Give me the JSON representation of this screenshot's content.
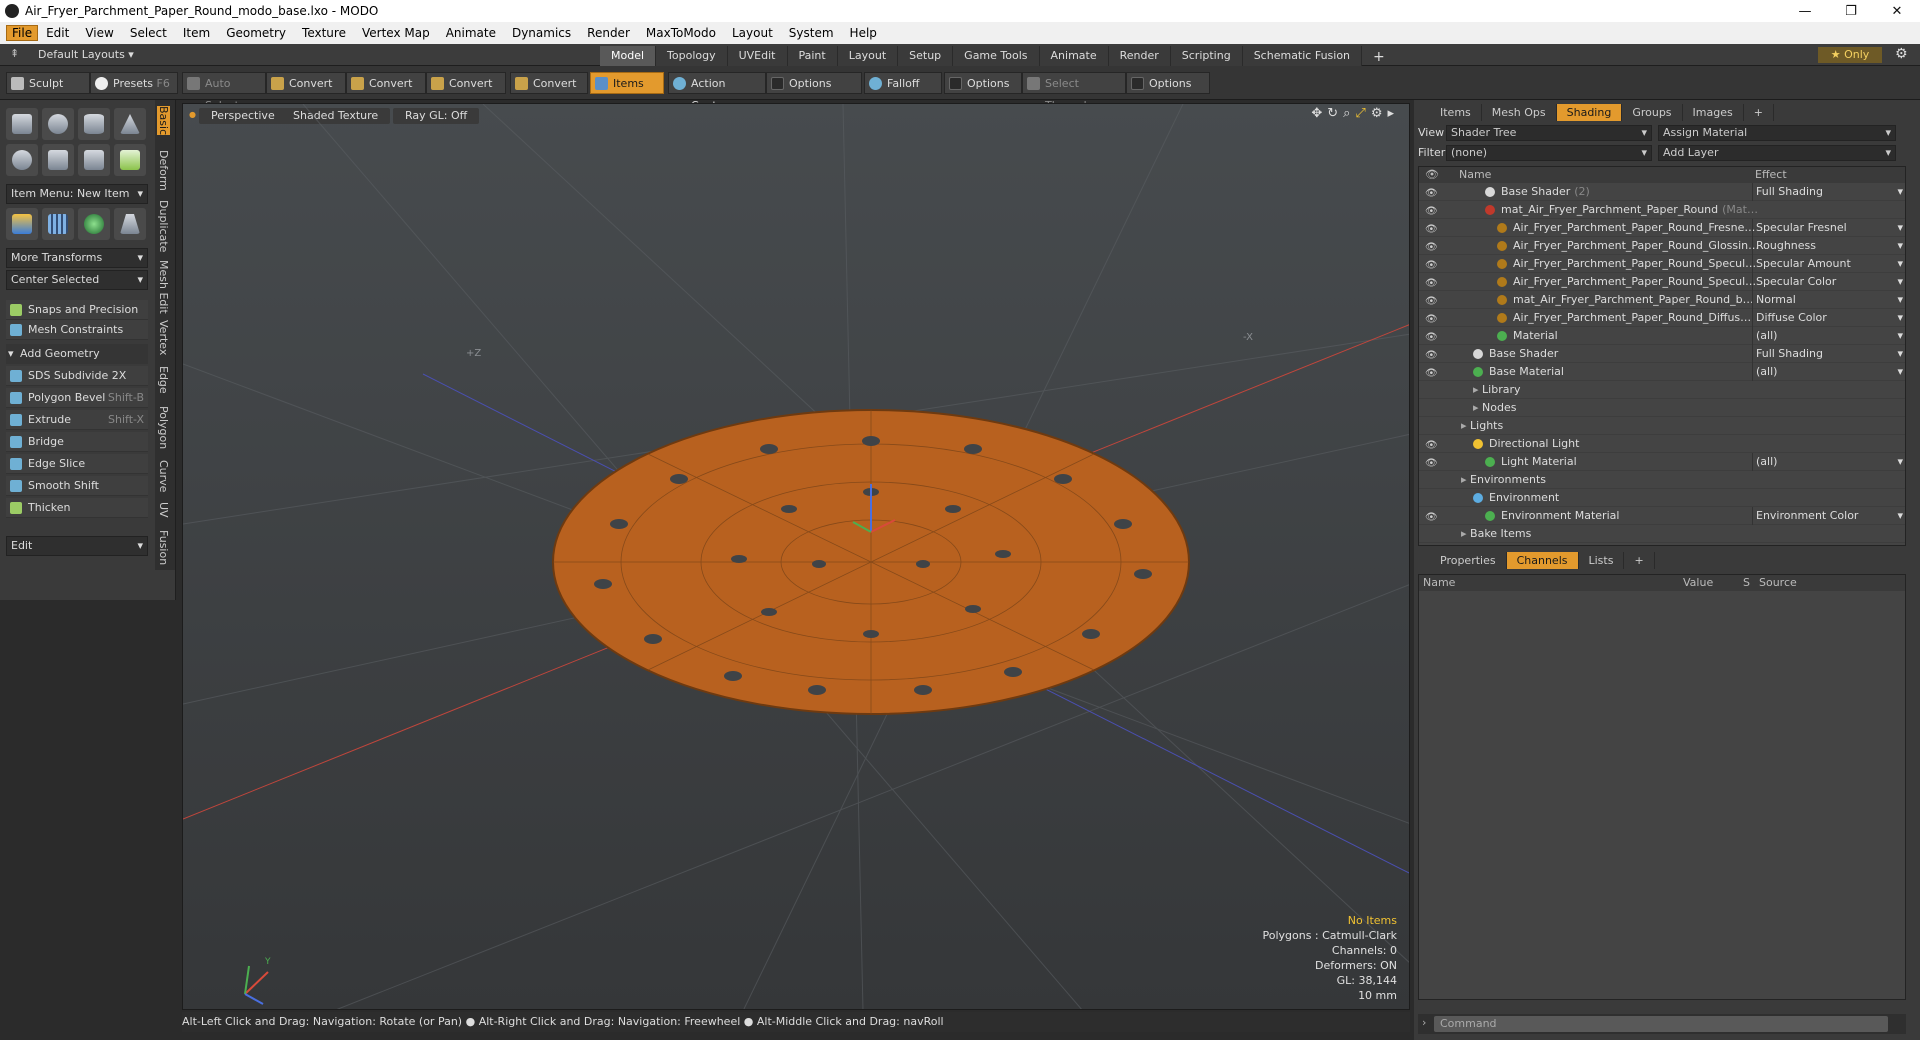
{
  "window": {
    "title": "Air_Fryer_Parchment_Paper_Round_modo_base.lxo - MODO",
    "minimize": "—",
    "restore": "❐",
    "close": "✕"
  },
  "menu": [
    "File",
    "Edit",
    "View",
    "Select",
    "Item",
    "Geometry",
    "Texture",
    "Vertex Map",
    "Animate",
    "Dynamics",
    "Render",
    "MaxToModo",
    "Layout",
    "System",
    "Help"
  ],
  "layout": {
    "default_layouts": "Default Layouts ▾",
    "tabs": [
      "Model",
      "Topology",
      "UVEdit",
      "Paint",
      "Layout",
      "Setup",
      "Game Tools",
      "Animate",
      "Render",
      "Scripting",
      "Schematic Fusion"
    ],
    "active_tab": "Model",
    "add_tab": "+",
    "only": "★ Only"
  },
  "toolbar": {
    "sculpt": "Sculpt",
    "presets": "Presets",
    "presets_key": "F6",
    "auto_select": "Auto Select",
    "convert1": "Convert",
    "convert2": "Convert",
    "convert3": "Convert",
    "convert4": "Convert",
    "items": "Items",
    "action_center": "Action Center",
    "options1": "Options",
    "falloff": "Falloff",
    "options2": "Options",
    "select_through": "Select Through",
    "options3": "Options"
  },
  "left": {
    "item_menu": "Item Menu: New Item",
    "more_transforms": "More Transforms",
    "center_selected": "Center Selected",
    "snaps": "Snaps and Precision",
    "mesh_constraints": "Mesh Constraints",
    "add_geometry": "Add Geometry",
    "tools": [
      {
        "label": "SDS Subdivide 2X",
        "key": ""
      },
      {
        "label": "Polygon Bevel",
        "key": "Shift-B"
      },
      {
        "label": "Extrude",
        "key": "Shift-X"
      },
      {
        "label": "Bridge",
        "key": ""
      },
      {
        "label": "Edge Slice",
        "key": ""
      },
      {
        "label": "Smooth Shift",
        "key": ""
      },
      {
        "label": "Thicken",
        "key": ""
      }
    ],
    "edit": "Edit",
    "vtabs": [
      "Basic",
      "Deform",
      "Duplicate",
      "Mesh Edit",
      "Vertex",
      "Edge",
      "Polygon",
      "Curve",
      "UV",
      "Fusion"
    ]
  },
  "viewport": {
    "perspective": "Perspective",
    "shading": "Shaded Texture",
    "raygl": "Ray GL: Off",
    "axis_label_z": "+Z",
    "axis_label_x": "-X",
    "gizmo_label": "Y",
    "stats": {
      "no_items": "No Items",
      "polygons": "Polygons : Catmull-Clark",
      "channels": "Channels: 0",
      "deformers": "Deformers: ON",
      "gl": "GL: 38,144",
      "scale": "10 mm"
    },
    "disc_color": "#b8611f"
  },
  "status": "Alt-Left Click and Drag: Navigation: Rotate (or Pan) ● Alt-Right Click and Drag: Navigation: Freewheel ● Alt-Middle Click and Drag: navRoll",
  "right": {
    "tabs": [
      "Items",
      "Mesh Ops",
      "Shading",
      "Groups",
      "Images"
    ],
    "active_tab": "Shading",
    "add": "+",
    "view_label": "View",
    "view_value": "Shader Tree",
    "assign_material": "Assign Material",
    "filter_label": "Filter",
    "filter_value": "(none)",
    "add_layer": "Add Layer",
    "col_name": "Name",
    "col_effect": "Effect",
    "tree": [
      {
        "name": "Base Shader",
        "extra": "(2)",
        "effect": "Full Shading",
        "indent": 3,
        "ball": "#d8d8d8",
        "eye": true
      },
      {
        "name": "mat_Air_Fryer_Parchment_Paper_Round",
        "extra": "(Mat…",
        "effect": "",
        "indent": 3,
        "ball": "#c0392b",
        "eye": true
      },
      {
        "name": "Air_Fryer_Parchment_Paper_Round_Fresne…",
        "extra": "",
        "effect": "Specular Fresnel",
        "indent": 4,
        "ball": "#b07a1a",
        "eye": true
      },
      {
        "name": "Air_Fryer_Parchment_Paper_Round_Glossin…",
        "extra": "",
        "effect": "Roughness",
        "indent": 4,
        "ball": "#b07a1a",
        "eye": true
      },
      {
        "name": "Air_Fryer_Parchment_Paper_Round_Specul…",
        "extra": "",
        "effect": "Specular Amount",
        "indent": 4,
        "ball": "#b07a1a",
        "eye": true
      },
      {
        "name": "Air_Fryer_Parchment_Paper_Round_Specul…",
        "extra": "",
        "effect": "Specular Color",
        "indent": 4,
        "ball": "#b07a1a",
        "eye": true
      },
      {
        "name": "mat_Air_Fryer_Parchment_Paper_Round_b…",
        "extra": "",
        "effect": "Normal",
        "indent": 4,
        "ball": "#b07a1a",
        "eye": true
      },
      {
        "name": "Air_Fryer_Parchment_Paper_Round_Diffus…",
        "extra": "",
        "effect": "Diffuse Color",
        "indent": 4,
        "ball": "#b07a1a",
        "eye": true
      },
      {
        "name": "Material",
        "extra": "",
        "effect": "(all)",
        "indent": 4,
        "ball": "#4caf50",
        "eye": true
      },
      {
        "name": "Base Shader",
        "extra": "",
        "effect": "Full Shading",
        "indent": 2,
        "ball": "#d8d8d8",
        "eye": true
      },
      {
        "name": "Base Material",
        "extra": "",
        "effect": "(all)",
        "indent": 2,
        "ball": "#4caf50",
        "eye": true
      },
      {
        "name": "Library",
        "extra": "",
        "effect": "",
        "indent": 2,
        "ball": "",
        "eye": false
      },
      {
        "name": "Nodes",
        "extra": "",
        "effect": "",
        "indent": 2,
        "ball": "",
        "eye": false
      },
      {
        "name": "Lights",
        "extra": "",
        "effect": "",
        "indent": 1,
        "ball": "",
        "eye": false
      },
      {
        "name": "Directional Light",
        "extra": "",
        "effect": "",
        "indent": 2,
        "ball": "#f1c232",
        "eye": true
      },
      {
        "name": "Light Material",
        "extra": "",
        "effect": "(all)",
        "indent": 3,
        "ball": "#4caf50",
        "eye": true
      },
      {
        "name": "Environments",
        "extra": "",
        "effect": "",
        "indent": 1,
        "ball": "",
        "eye": false
      },
      {
        "name": "Environment",
        "extra": "",
        "effect": "",
        "indent": 2,
        "ball": "#5dade2",
        "eye": false
      },
      {
        "name": "Environment Material",
        "extra": "",
        "effect": "Environment Color",
        "indent": 3,
        "ball": "#4caf50",
        "eye": true
      },
      {
        "name": "Bake Items",
        "extra": "",
        "effect": "",
        "indent": 1,
        "ball": "",
        "eye": false
      }
    ],
    "bottom_tabs": [
      "Properties",
      "Channels",
      "Lists"
    ],
    "bottom_active": "Channels",
    "chan_cols": [
      "Name",
      "Value",
      "S",
      "Source"
    ],
    "command_placeholder": "Command"
  }
}
